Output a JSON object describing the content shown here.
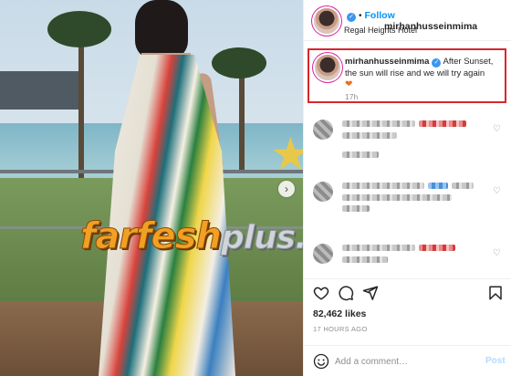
{
  "post": {
    "username": "mirhanhusseinmima",
    "follow_label": "Follow",
    "dot": "•",
    "location": "Regal Heights Hotel",
    "more_icon": "more-icon",
    "next_arrow": "›"
  },
  "watermark": {
    "part1": "farfesh",
    "part2": "plus.com"
  },
  "caption": {
    "username": "mirhanhusseinmima",
    "text": "After Sunset, the sun will rise and we will try again",
    "heart": "❤",
    "heart_color": "#ef6c1a",
    "time": "17h"
  },
  "icons": {
    "like": "heart-icon",
    "comment": "comment-icon",
    "share": "share-icon",
    "save": "bookmark-icon",
    "emoji": "smiley-icon",
    "verified": "verified-icon"
  },
  "stats": {
    "likes": "82,462 likes",
    "posted": "17 HOURS AGO"
  },
  "add_comment": {
    "placeholder": "Add a comment…",
    "post_label": "Post"
  },
  "colors": {
    "accent": "#0095f6",
    "verified": "#3897f0",
    "highlight_border": "#d9262e",
    "muted": "#8e8e8e"
  }
}
